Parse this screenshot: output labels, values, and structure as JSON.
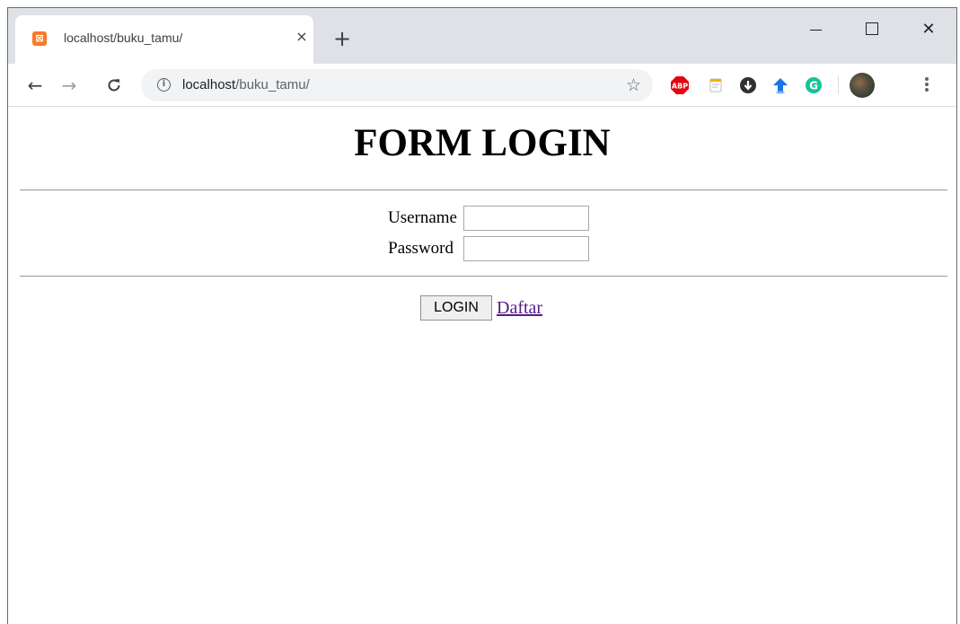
{
  "browser": {
    "tab": {
      "title": "localhost/buku_tamu/",
      "favicon": "xampp-icon",
      "close_glyph": "×"
    },
    "new_tab_glyph": "+",
    "window_controls": {
      "close_glyph": "✕"
    },
    "nav": {
      "back_glyph": "←",
      "forward_glyph": "→",
      "reload_glyph": "C"
    },
    "address": {
      "host": "localhost",
      "path": "/buku_tamu/",
      "info_glyph": "i"
    },
    "star_glyph": "☆",
    "extensions": [
      {
        "name": "adblock-plus-icon",
        "label": "ABP",
        "color": "#e30612"
      },
      {
        "name": "notes-extension-icon",
        "color": "#f4b400"
      },
      {
        "name": "shield-extension-icon",
        "color": "#303134"
      },
      {
        "name": "arrow-extension-icon",
        "color": "#1a73e8"
      },
      {
        "name": "grammarly-icon",
        "label": "G",
        "color": "#15c39a"
      }
    ]
  },
  "page": {
    "title": "FORM LOGIN",
    "form": {
      "username_label": "Username",
      "username_value": "",
      "password_label": "Password",
      "password_value": ""
    },
    "login_button": "LOGIN",
    "register_link": "Daftar"
  }
}
